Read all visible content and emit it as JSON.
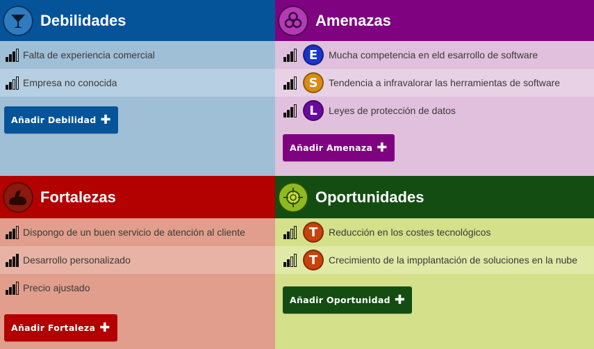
{
  "debilidades": {
    "title": "Debilidades",
    "icon": "cocktail-glass-icon",
    "items": [
      {
        "text": "Falta de experiencia comercial",
        "level": 3
      },
      {
        "text": "Empresa no conocida",
        "level": 2
      }
    ],
    "button": "Añadir Debilidad",
    "color": "#05549a"
  },
  "amenazas": {
    "title": "Amenazas",
    "icon": "biohazard-icon",
    "items": [
      {
        "text": "Mucha competencia en eld esarrollo de software",
        "level": 3,
        "badge": "E",
        "badge_color": "#1a34c9"
      },
      {
        "text": "Tendencia a infravalorar las herramientas de software",
        "level": 3,
        "badge": "S",
        "badge_color": "#d98b14"
      },
      {
        "text": "Leyes de protección de datos",
        "level": 3,
        "badge": "L",
        "badge_color": "#6a0a9c"
      }
    ],
    "button": "Añadir Amenaza",
    "color": "#7f0380"
  },
  "fortalezas": {
    "title": "Fortalezas",
    "icon": "flexed-arm-icon",
    "items": [
      {
        "text": "Dispongo de un buen servicio de atención al cliente",
        "level": 3
      },
      {
        "text": "Desarrollo personalizado",
        "level": 4
      },
      {
        "text": "Precio ajustado",
        "level": 3
      }
    ],
    "button": "Añadir Fortaleza",
    "color": "#b30000"
  },
  "oportunidades": {
    "title": "Oportunidades",
    "icon": "target-crosshair-icon",
    "items": [
      {
        "text": "Reducción en los costes tecnológicos",
        "level": 2,
        "badge": "T",
        "badge_color": "#c8420c"
      },
      {
        "text": "Crecimiento de la impplantación de soluciones en la nube",
        "level": 2,
        "badge": "T",
        "badge_color": "#c8420c"
      }
    ],
    "button": "Añadir Oportunidad",
    "color": "#134d12"
  }
}
